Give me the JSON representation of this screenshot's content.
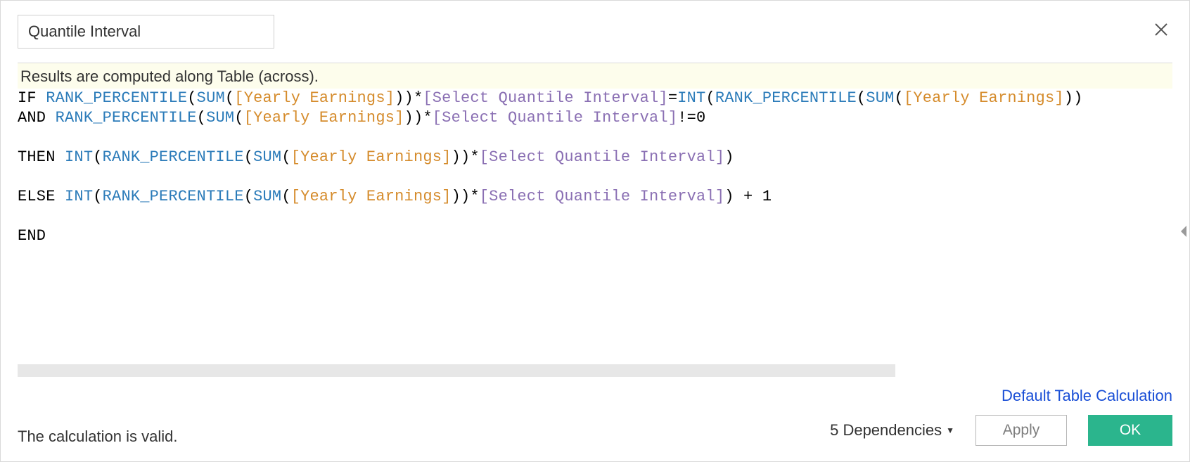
{
  "header": {
    "calc_name": "Quantile Interval"
  },
  "info_banner": "Results are computed along Table (across).",
  "formula": {
    "functions": {
      "rank_percentile": "RANK_PERCENTILE",
      "sum": "SUM",
      "int": "INT"
    },
    "fields": {
      "yearly_earnings": "[Yearly Earnings]"
    },
    "params": {
      "select_quantile_interval": "[Select Quantile Interval]"
    },
    "keywords": {
      "if": "IF",
      "and": "AND",
      "then": "THEN",
      "else": "ELSE",
      "end": "END"
    },
    "literals": {
      "zero": "0",
      "one": "1"
    },
    "ops": {
      "eq": "=",
      "neq": "!=",
      "mul": "*",
      "plus": " + "
    }
  },
  "scrollbar": {
    "thumb_pct": 76
  },
  "footer": {
    "validation_msg": "The calculation is valid.",
    "default_table_calc": "Default Table Calculation",
    "dependencies_label": "5 Dependencies",
    "apply_label": "Apply",
    "ok_label": "OK"
  }
}
